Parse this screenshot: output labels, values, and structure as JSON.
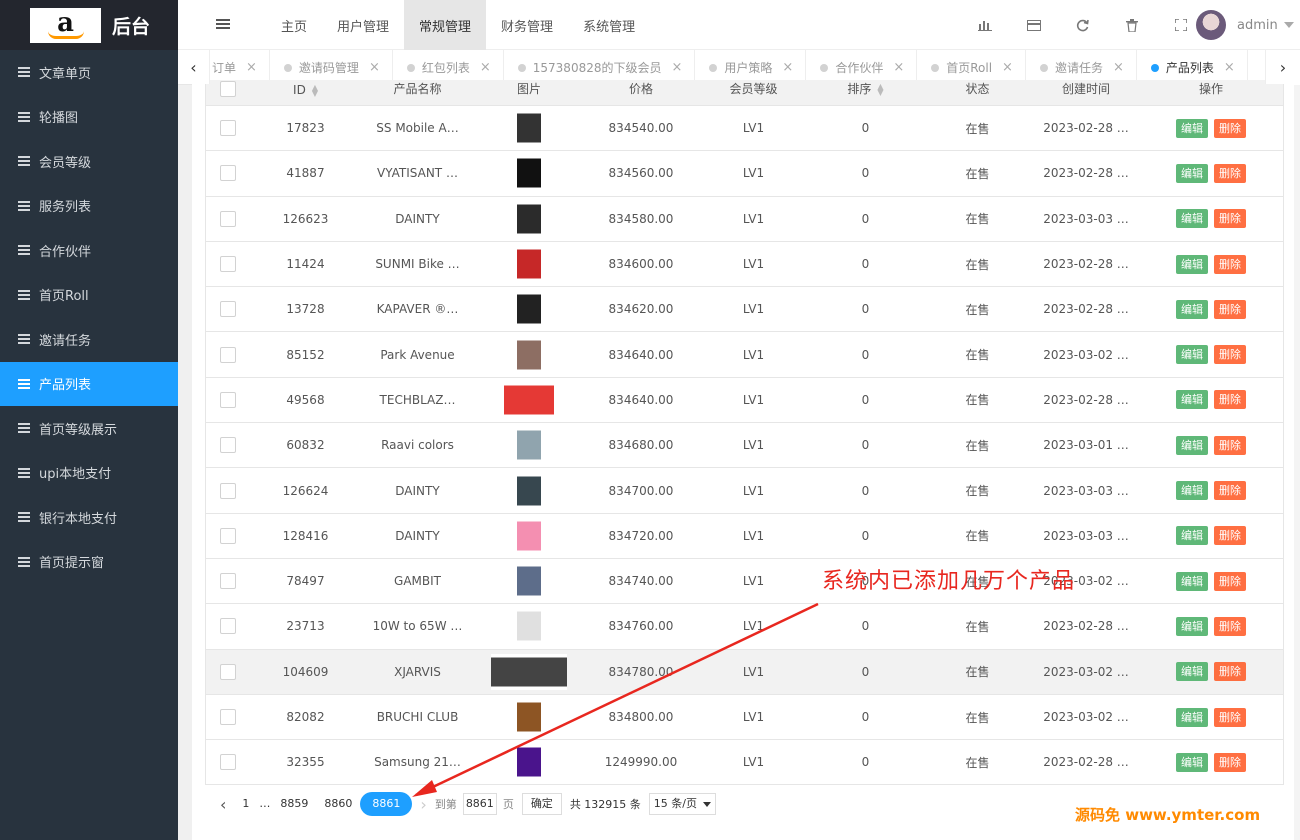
{
  "brand": {
    "logo_letter": "a",
    "title": "后台"
  },
  "sidebar": {
    "items": [
      {
        "label": "文章单页",
        "active": false
      },
      {
        "label": "轮播图",
        "active": false
      },
      {
        "label": "会员等级",
        "active": false
      },
      {
        "label": "服务列表",
        "active": false
      },
      {
        "label": "合作伙伴",
        "active": false
      },
      {
        "label": "首页Roll",
        "active": false
      },
      {
        "label": "邀请任务",
        "active": false
      },
      {
        "label": "产品列表",
        "active": true
      },
      {
        "label": "首页等级展示",
        "active": false
      },
      {
        "label": "upi本地支付",
        "active": false
      },
      {
        "label": "银行本地支付",
        "active": false
      },
      {
        "label": "首页提示窗",
        "active": false
      }
    ]
  },
  "header": {
    "nav": [
      {
        "label": "主页",
        "active": false
      },
      {
        "label": "用户管理",
        "active": false
      },
      {
        "label": "常规管理",
        "active": true
      },
      {
        "label": "财务管理",
        "active": false
      },
      {
        "label": "系统管理",
        "active": false
      }
    ],
    "icons": [
      "chart-icon",
      "card-icon",
      "refresh-icon",
      "trash-icon",
      "fullscreen-icon"
    ],
    "user": "admin"
  },
  "tabs": [
    {
      "label": "订单",
      "active": false
    },
    {
      "label": "邀请码管理",
      "active": false
    },
    {
      "label": "红包列表",
      "active": false
    },
    {
      "label": "157380828的下级会员",
      "active": false
    },
    {
      "label": "用户策略",
      "active": false
    },
    {
      "label": "合作伙伴",
      "active": false
    },
    {
      "label": "首页Roll",
      "active": false
    },
    {
      "label": "邀请任务",
      "active": false
    },
    {
      "label": "产品列表",
      "active": true
    }
  ],
  "table": {
    "columns": [
      "",
      "ID",
      "产品名称",
      "图片",
      "价格",
      "会员等级",
      "排序",
      "状态",
      "创建时间",
      "操作"
    ],
    "edit_label": "编辑",
    "delete_label": "删除",
    "rows": [
      {
        "id": "17823",
        "name": "SS Mobile A…",
        "price": "834540.00",
        "level": "LV1",
        "sort": "0",
        "status": "在售",
        "created": "2023-02-28 …",
        "thumb": "#333"
      },
      {
        "id": "41887",
        "name": "VYATISANT …",
        "price": "834560.00",
        "level": "LV1",
        "sort": "0",
        "status": "在售",
        "created": "2023-02-28 …",
        "thumb": "#111"
      },
      {
        "id": "126623",
        "name": "DAINTY",
        "price": "834580.00",
        "level": "LV1",
        "sort": "0",
        "status": "在售",
        "created": "2023-03-03 …",
        "thumb": "#2b2b2b"
      },
      {
        "id": "11424",
        "name": "SUNMI Bike …",
        "price": "834600.00",
        "level": "LV1",
        "sort": "0",
        "status": "在售",
        "created": "2023-02-28 …",
        "thumb": "#c62828"
      },
      {
        "id": "13728",
        "name": "KAPAVER ®…",
        "price": "834620.00",
        "level": "LV1",
        "sort": "0",
        "status": "在售",
        "created": "2023-02-28 …",
        "thumb": "#222"
      },
      {
        "id": "85152",
        "name": "Park Avenue",
        "price": "834640.00",
        "level": "LV1",
        "sort": "0",
        "status": "在售",
        "created": "2023-03-02 …",
        "thumb": "#8d6e63"
      },
      {
        "id": "49568",
        "name": "TECHBLAZ…",
        "price": "834640.00",
        "level": "LV1",
        "sort": "0",
        "status": "在售",
        "created": "2023-02-28 …",
        "thumb": "#e53935"
      },
      {
        "id": "60832",
        "name": "Raavi colors",
        "price": "834680.00",
        "level": "LV1",
        "sort": "0",
        "status": "在售",
        "created": "2023-03-01 …",
        "thumb": "#90a4ae"
      },
      {
        "id": "126624",
        "name": "DAINTY",
        "price": "834700.00",
        "level": "LV1",
        "sort": "0",
        "status": "在售",
        "created": "2023-03-03 …",
        "thumb": "#37474f"
      },
      {
        "id": "128416",
        "name": "DAINTY",
        "price": "834720.00",
        "level": "LV1",
        "sort": "0",
        "status": "在售",
        "created": "2023-03-03 …",
        "thumb": "#f48fb1"
      },
      {
        "id": "78497",
        "name": "GAMBIT",
        "price": "834740.00",
        "level": "LV1",
        "sort": "0",
        "status": "在售",
        "created": "2023-03-02 …",
        "thumb": "#5d6d8a"
      },
      {
        "id": "23713",
        "name": "10W to 65W …",
        "price": "834760.00",
        "level": "LV1",
        "sort": "0",
        "status": "在售",
        "created": "2023-02-28 …",
        "thumb": "#e0e0e0"
      },
      {
        "id": "104609",
        "name": "XJARVIS",
        "price": "834780.00",
        "level": "LV1",
        "sort": "0",
        "status": "在售",
        "created": "2023-03-02 …",
        "thumb": "#444"
      },
      {
        "id": "82082",
        "name": "BRUCHI CLUB",
        "price": "834800.00",
        "level": "LV1",
        "sort": "0",
        "status": "在售",
        "created": "2023-03-02 …",
        "thumb": "#8d5524"
      },
      {
        "id": "32355",
        "name": "Samsung 21…",
        "price": "1249990.00",
        "level": "LV1",
        "sort": "0",
        "status": "在售",
        "created": "2023-02-28 …",
        "thumb": "#4a148c"
      }
    ]
  },
  "pager": {
    "first": "1",
    "ellipsis": "…",
    "pages": [
      "8859",
      "8860"
    ],
    "current": "8861",
    "goto_label": "到第",
    "goto_value": "8861",
    "page_unit": "页",
    "confirm": "确定",
    "total": "共 132915 条",
    "per_page": "15 条/页"
  },
  "annotation": "系统内已添加几万个产品",
  "watermark": "源码免 www.ymter.com",
  "colors": {
    "primary": "#1e9fff",
    "sidebar": "#28333e",
    "edit": "#5fb878",
    "delete": "#ff5722",
    "annotation": "#e8271f"
  }
}
